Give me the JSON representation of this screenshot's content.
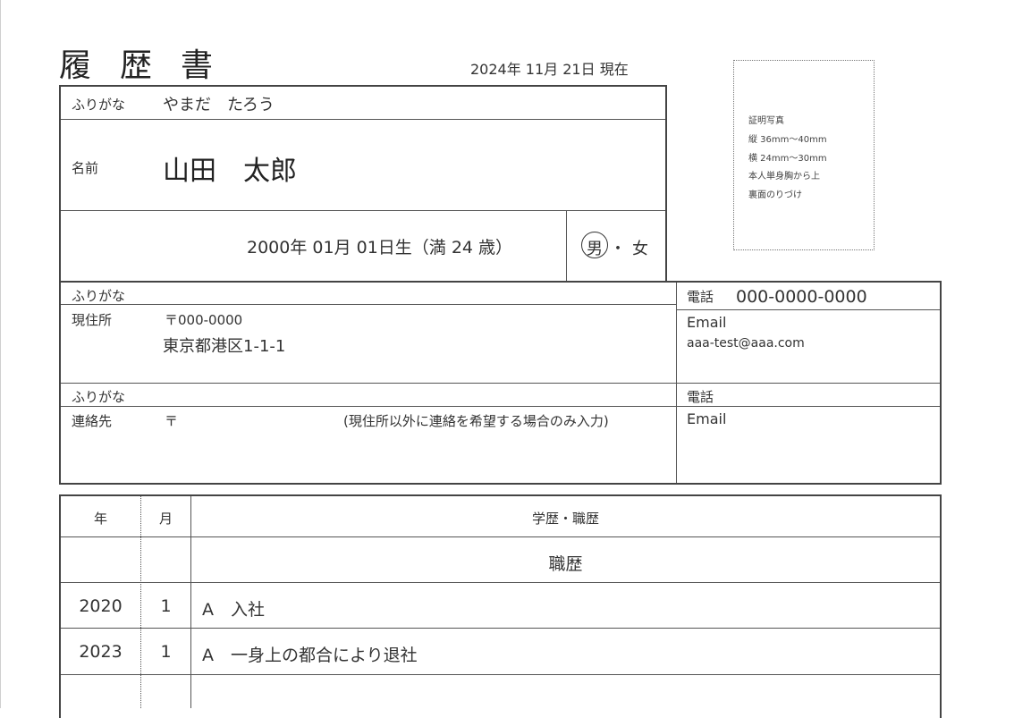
{
  "header": {
    "title": "履歴書",
    "date": "2024年 11月 21日 現在"
  },
  "personal": {
    "furigana_label": "ふりがな",
    "furigana_value": "やまだ　たろう",
    "name_label": "名前",
    "name_value": "山田　太郎",
    "birth_text": "2000年 01月 01日生（満 24 歳）",
    "gender_male": "男",
    "gender_sep": "・",
    "gender_female": "女"
  },
  "photo": {
    "lines": [
      "証明写真",
      "縦 36mm〜40mm",
      "横 24mm〜30mm",
      "本人単身胸から上",
      "裏面のりづけ"
    ]
  },
  "address": {
    "furigana_label": "ふりがな",
    "label": "現住所",
    "postal": "〒000-0000",
    "value": "東京都港区1-1-1",
    "phone_label": "電話",
    "phone_value": "000-0000-0000",
    "email_label": "Email",
    "email_value": "aaa-test@aaa.com"
  },
  "contact": {
    "furigana_label": "ふりがな",
    "label": "連絡先",
    "postal": "〒",
    "note": "(現住所以外に連絡を希望する場合のみ入力)",
    "phone_label": "電話",
    "email_label": "Email"
  },
  "history": {
    "col_year": "年",
    "col_month": "月",
    "col_detail": "学歴・職歴",
    "section_title": "職歴",
    "rows": [
      {
        "year": "2020",
        "month": "1",
        "detail": "A　入社"
      },
      {
        "year": "2023",
        "month": "1",
        "detail": "A　一身上の都合により退社"
      }
    ]
  }
}
